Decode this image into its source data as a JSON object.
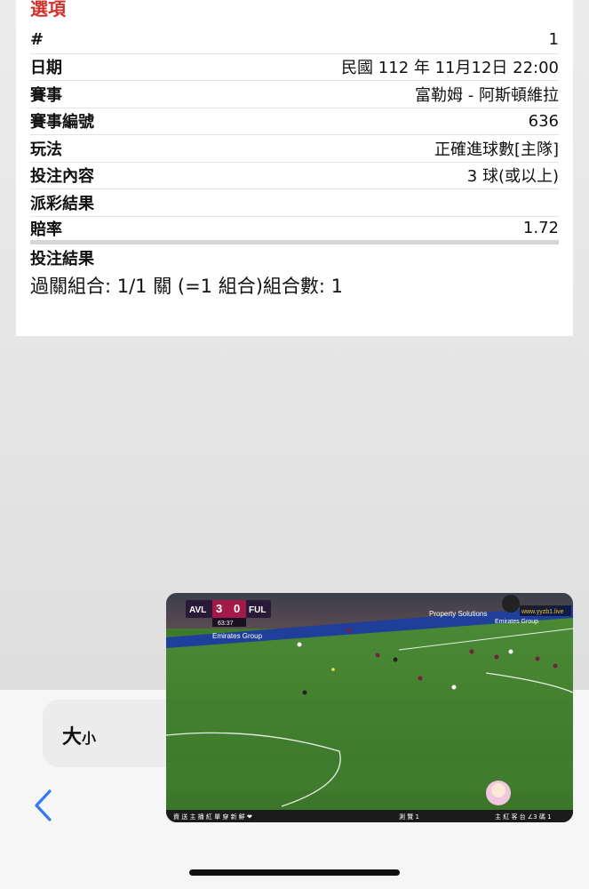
{
  "section_title": "選項",
  "rows": [
    {
      "label": "#",
      "value": "1"
    },
    {
      "label": "日期",
      "value": "民國 112 年 11月12日 22:00"
    },
    {
      "label": "賽事",
      "value": "富勒姆 - 阿斯頓維拉"
    },
    {
      "label": "賽事編號",
      "value": "636"
    },
    {
      "label": "玩法",
      "value": "正確進球數[主隊]"
    },
    {
      "label": "投注內容",
      "value": "3 球(或以上)"
    },
    {
      "label": "派彩結果",
      "value": ""
    },
    {
      "label": "賠率",
      "value": "1.72"
    },
    {
      "label": "投注結果",
      "value": ""
    }
  ],
  "combo_text": "過關組合: 1/1 關 (=1 組合)組合數: 1",
  "size_button": {
    "big": "大",
    "small": "小"
  },
  "video": {
    "home_team": "AVL",
    "away_team": "FUL",
    "home_score": "3",
    "away_score": "0",
    "clock": "63:37",
    "watermark": "www.yyzb1.live",
    "ads": [
      "Emirates Group",
      "Property Solutions",
      "Emirates Group"
    ],
    "ticker_left": "資 送 主 播 紅 單 穿 新 鮮 ❤",
    "ticker_mid": "測 覽 1",
    "ticker_right": "主 紅 客 台  ∠3  碼 1"
  },
  "colors": {
    "accent": "#d0312d",
    "pitch": "#3d7a2a",
    "ios_blue": "#3478f6"
  },
  "icons": {
    "back": "chevron-left-icon"
  }
}
